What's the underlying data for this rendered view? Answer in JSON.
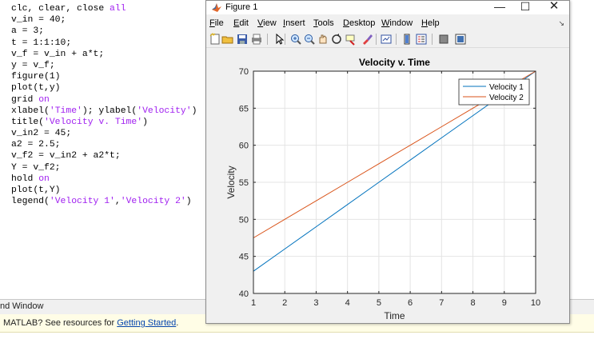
{
  "editor": {
    "lines": [
      [
        {
          "t": "clc, clear, close ",
          "c": ""
        },
        {
          "t": "all",
          "c": "str"
        }
      ],
      [
        {
          "t": "v_in = 40;",
          "c": ""
        }
      ],
      [
        {
          "t": "a = 3;",
          "c": ""
        }
      ],
      [
        {
          "t": "t = 1:1:10;",
          "c": ""
        }
      ],
      [
        {
          "t": "v_f = v_in + a*t;",
          "c": ""
        }
      ],
      [
        {
          "t": "y = v_f;",
          "c": ""
        }
      ],
      [
        {
          "t": "figure(1)",
          "c": ""
        }
      ],
      [
        {
          "t": "plot(t,y)",
          "c": ""
        }
      ],
      [
        {
          "t": "grid ",
          "c": ""
        },
        {
          "t": "on",
          "c": "str"
        }
      ],
      [
        {
          "t": "xlabel(",
          "c": ""
        },
        {
          "t": "'Time'",
          "c": "str"
        },
        {
          "t": "); ylabel(",
          "c": ""
        },
        {
          "t": "'Velocity'",
          "c": "str"
        },
        {
          "t": ")",
          "c": ""
        }
      ],
      [
        {
          "t": "title(",
          "c": ""
        },
        {
          "t": "'Velocity v. Time'",
          "c": "str"
        },
        {
          "t": ")",
          "c": ""
        }
      ],
      [
        {
          "t": "v_in2 = 45;",
          "c": ""
        }
      ],
      [
        {
          "t": "a2 = 2.5;",
          "c": ""
        }
      ],
      [
        {
          "t": "v_f2 = v_in2 + a2*t;",
          "c": ""
        }
      ],
      [
        {
          "t": "Y = v_f2;",
          "c": ""
        }
      ],
      [
        {
          "t": "hold ",
          "c": ""
        },
        {
          "t": "on",
          "c": "str"
        }
      ],
      [
        {
          "t": "plot(t,Y)",
          "c": ""
        }
      ],
      [
        {
          "t": "legend(",
          "c": ""
        },
        {
          "t": "'Velocity 1'",
          "c": "str"
        },
        {
          "t": ",",
          "c": ""
        },
        {
          "t": "'Velocity 2'",
          "c": "str"
        },
        {
          "t": ")",
          "c": ""
        }
      ]
    ]
  },
  "command_window": {
    "title": "nd Window",
    "prefix": "MATLAB? See resources for ",
    "link": "Getting Started",
    "suffix": "."
  },
  "figure": {
    "title": "Figure 1",
    "buttons": {
      "minimize": "—",
      "maximize": "☐",
      "close": "✕"
    },
    "menus": [
      {
        "u": "F",
        "rest": "ile"
      },
      {
        "u": "E",
        "rest": "dit"
      },
      {
        "u": "V",
        "rest": "iew"
      },
      {
        "u": "I",
        "rest": "nsert"
      },
      {
        "u": "T",
        "rest": "ools"
      },
      {
        "u": "D",
        "rest": "esktop"
      },
      {
        "u": "W",
        "rest": "indow"
      },
      {
        "u": "H",
        "rest": "elp"
      }
    ],
    "menu_arrow": "↘",
    "toolbar_icons": [
      "new-figure-icon",
      "open-file-icon",
      "save-icon",
      "print-icon",
      "pointer-icon",
      "zoom-in-icon",
      "zoom-out-icon",
      "pan-icon",
      "rotate-3d-icon",
      "data-cursor-icon",
      "brush-icon",
      "link-plot-icon",
      "colorbar-icon",
      "legend-icon",
      "hide-plot-tools-icon",
      "show-plot-tools-icon"
    ]
  },
  "chart_data": {
    "type": "line",
    "title": "Velocity v. Time",
    "xlabel": "Time",
    "ylabel": "Velocity",
    "xlim": [
      1,
      10
    ],
    "ylim": [
      40,
      70
    ],
    "xticks": [
      1,
      2,
      3,
      4,
      5,
      6,
      7,
      8,
      9,
      10
    ],
    "yticks": [
      40,
      45,
      50,
      55,
      60,
      65,
      70
    ],
    "grid": true,
    "legend_position": "top-right",
    "x": [
      1,
      2,
      3,
      4,
      5,
      6,
      7,
      8,
      9,
      10
    ],
    "series": [
      {
        "name": "Velocity 1",
        "color": "#0072bd",
        "values": [
          43,
          46,
          49,
          52,
          55,
          58,
          61,
          64,
          67,
          70
        ]
      },
      {
        "name": "Velocity 2",
        "color": "#d95319",
        "values": [
          47.5,
          50,
          52.5,
          55,
          57.5,
          60,
          62.5,
          65,
          67.5,
          70
        ]
      }
    ]
  }
}
